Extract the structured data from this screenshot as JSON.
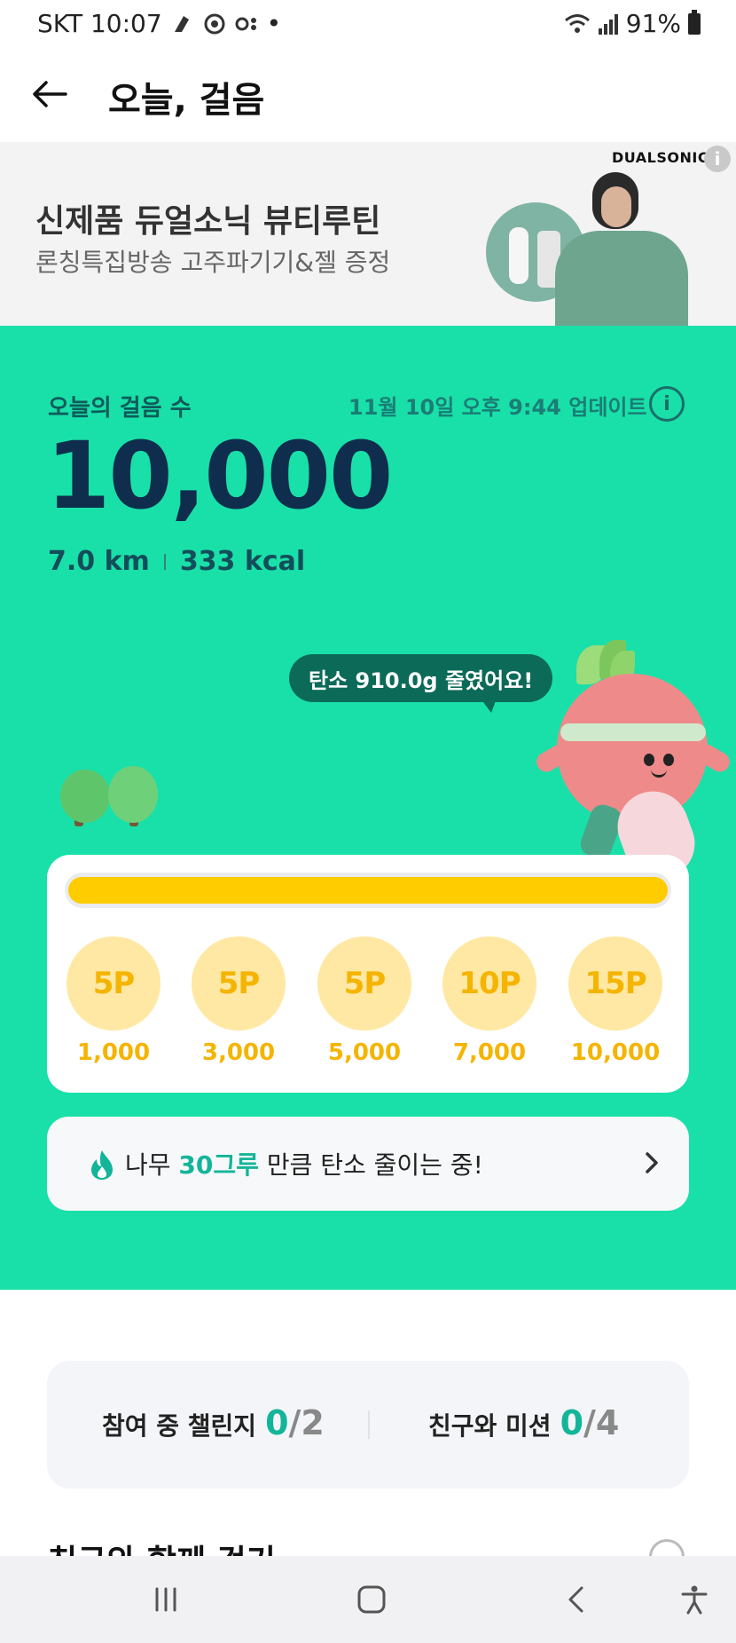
{
  "status_bar": {
    "carrier_time": "SKT 10:07",
    "dot": "•",
    "battery": "91%"
  },
  "app_bar": {
    "title": "오늘, 걸음"
  },
  "ad": {
    "brand": "DUALSONIC",
    "info": "i",
    "title": "신제품 듀얼소닉 뷰티루틴",
    "subtitle": "론칭특집방송 고주파기기&젤 증정"
  },
  "today": {
    "label": "오늘의 걸음 수",
    "update": "11월 10일 오후 9:44 업데이트",
    "info": "i",
    "steps": "10,000",
    "distance": "7.0 km",
    "calories": "333 kcal",
    "carbon_bubble": "탄소 910.0g 줄였어요!",
    "progress_percent": 100
  },
  "rewards": [
    {
      "points": "5P",
      "steps": "1,000"
    },
    {
      "points": "5P",
      "steps": "3,000"
    },
    {
      "points": "5P",
      "steps": "5,000"
    },
    {
      "points": "10P",
      "steps": "7,000"
    },
    {
      "points": "15P",
      "steps": "10,000"
    }
  ],
  "carbon_banner": {
    "prefix": "나무 ",
    "highlight": "30그루",
    "suffix": " 만큼 탄소 줄이는 중!"
  },
  "summary": {
    "challenge_label": "참여 중 챌린지",
    "challenge_done": "0",
    "challenge_total": "/2",
    "mission_label": "친구와 미션",
    "mission_done": "0",
    "mission_total": "/4"
  },
  "section": {
    "title": "친구와 함께 걷기"
  },
  "colors": {
    "green": "#19e0a8",
    "accent": "#13b59a",
    "navy": "#0f2d4d",
    "yellow": "#ffcc00"
  }
}
